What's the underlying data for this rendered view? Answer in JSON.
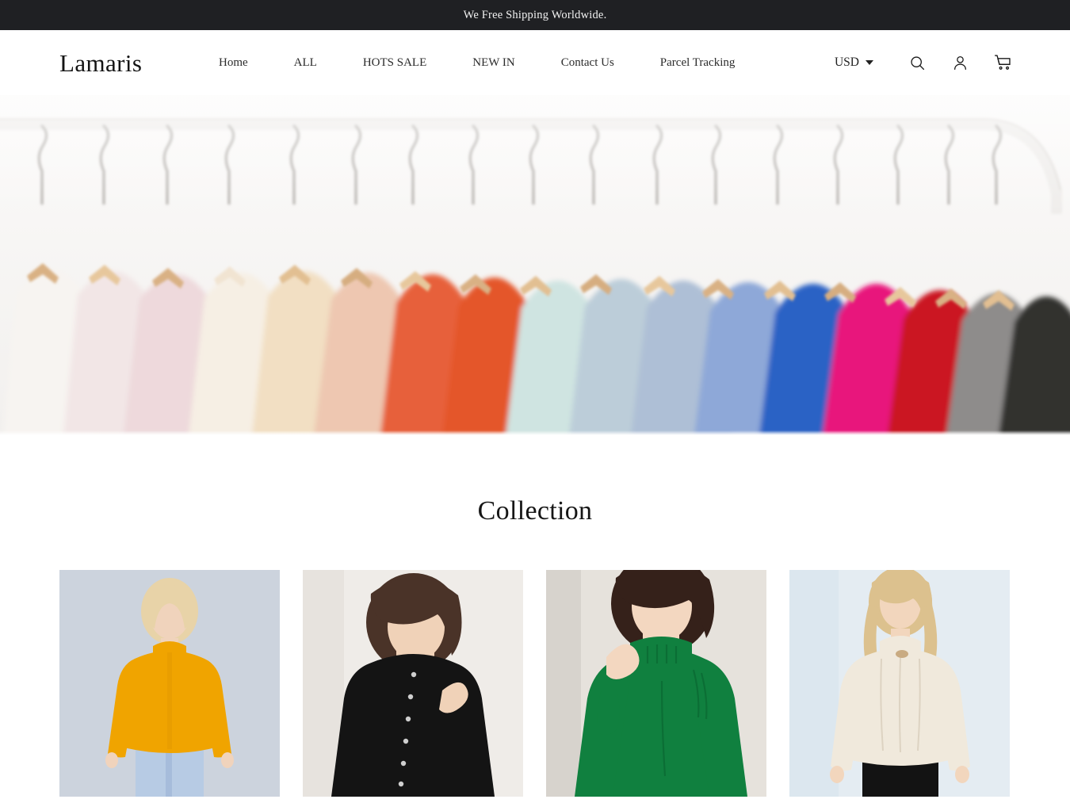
{
  "announcement": {
    "text": "We Free Shipping Worldwide."
  },
  "header": {
    "logo": "Lamaris",
    "nav": [
      {
        "label": "Home",
        "name": "nav-item-home"
      },
      {
        "label": "ALL",
        "name": "nav-item-all"
      },
      {
        "label": "HOTS SALE",
        "name": "nav-item-hots-sale"
      },
      {
        "label": "NEW IN",
        "name": "nav-item-new-in"
      },
      {
        "label": "Contact Us",
        "name": "nav-item-contact-us"
      },
      {
        "label": "Parcel Tracking",
        "name": "nav-item-parcel-tracking"
      }
    ],
    "currency": {
      "label": "USD",
      "icon": "chevron-down-icon"
    },
    "icons": [
      {
        "name": "search-icon",
        "label": "Search"
      },
      {
        "name": "account-icon",
        "label": "Account"
      },
      {
        "name": "cart-icon",
        "label": "Cart"
      }
    ]
  },
  "hero": {
    "alt": "Clothing rack with garments on wooden hangers",
    "garment_colors": [
      "#f6f3f0",
      "#f0d9d7",
      "#f7efe4",
      "#efe2cf",
      "#f0cfc2",
      "#e8643a",
      "#e8603a",
      "#f19f86",
      "#cfe3e0",
      "#b9cbd6",
      "#aebfd4",
      "#8fa9d8",
      "#2f66c8",
      "#e8197c",
      "#cf1020",
      "#8d8d8d",
      "#2b2b2b"
    ],
    "rail_color": "#efeeec",
    "background": "#f6f5f3"
  },
  "collection": {
    "title": "Collection",
    "products": [
      {
        "name": "product-card-1",
        "alt": "Woman in mustard yellow turtleneck sweater",
        "sweater": "#f0a400",
        "bottom": "#b7cbe4",
        "bg": "#ccd3dd",
        "hair": "#e8d3a8",
        "skin": "#f0d3bc"
      },
      {
        "name": "product-card-2",
        "alt": "Woman in black buttoned cardigan",
        "sweater": "#141414",
        "bottom": "#141414",
        "bg": "#efece8",
        "hair": "#4a3328",
        "skin": "#f0d2b8"
      },
      {
        "name": "product-card-3",
        "alt": "Woman in green mock neck sweater",
        "sweater": "#10803f",
        "bottom": "#10803f",
        "bg": "#e6e2dc",
        "hair": "#35211a",
        "skin": "#f3d7c0"
      },
      {
        "name": "product-card-4",
        "alt": "Woman in cream turtleneck sweater with black pants",
        "sweater": "#f0e9dc",
        "bottom": "#131313",
        "bg": "#e4ecf2",
        "hair": "#dcc18e",
        "skin": "#f2d6bd"
      }
    ]
  }
}
